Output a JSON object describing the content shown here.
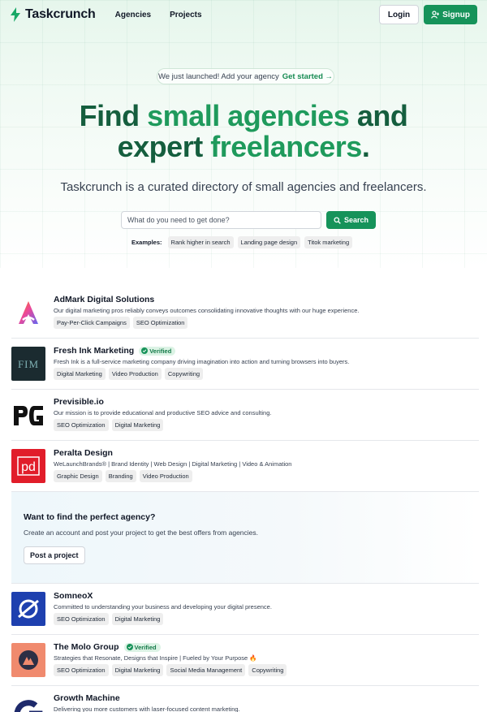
{
  "header": {
    "brand": "Taskcrunch",
    "nav": [
      "Agencies",
      "Projects"
    ],
    "login_label": "Login",
    "signup_label": "Signup"
  },
  "hero": {
    "pill_text": "We just launched! Add your agency",
    "pill_cta": "Get started →",
    "title_line1_a": "Find ",
    "title_line1_b": "small agencies",
    "title_line1_c": " and",
    "title_line2_a": "expert ",
    "title_line2_b": "freelancers",
    "title_line2_c": ".",
    "subtitle": "Taskcrunch is a curated directory of small agencies and freelancers.",
    "search_placeholder": "What do you need to get done?",
    "search_label": "Search",
    "examples_label": "Examples:",
    "examples": [
      "Rank higher in search",
      "Landing page design",
      "Titok marketing"
    ]
  },
  "listings": [
    {
      "name": "AdMark Digital Solutions",
      "verified": false,
      "description": "Our digital marketing pros reliably conveys outcomes consolidating innovative thoughts with our huge experience.",
      "tags": [
        "Pay-Per-Click Campaigns",
        "SEO Optimization"
      ]
    },
    {
      "name": "Fresh Ink Marketing",
      "verified": true,
      "description": "Fresh Ink is a full-service marketing company driving imagination into action and turning browsers into buyers.",
      "tags": [
        "Digital Marketing",
        "Video Production",
        "Copywriting"
      ]
    },
    {
      "name": "Previsible.io",
      "verified": false,
      "description": "Our mission is to provide educational and productive SEO advice and consulting.",
      "tags": [
        "SEO Optimization",
        "Digital Marketing"
      ]
    },
    {
      "name": "Peralta Design",
      "verified": false,
      "description": "WeLaunchBrands® | Brand Identity | Web Design | Digital Marketing | Video & Animation",
      "tags": [
        "Graphic Design",
        "Branding",
        "Video Production"
      ]
    },
    {
      "name": "SomneoX",
      "verified": false,
      "description": "Committed to understanding your business and developing your digital presence.",
      "tags": [
        "SEO Optimization",
        "Digital Marketing"
      ]
    },
    {
      "name": "The Molo Group",
      "verified": true,
      "description": "Strategies that Resonate, Designs that Inspire | Fueled by Your Purpose 🔥",
      "tags": [
        "SEO Optimization",
        "Digital Marketing",
        "Social Media Management",
        "Copywriting"
      ]
    },
    {
      "name": "Growth Machine",
      "verified": false,
      "description": "Delivering you more customers with laser-focused content marketing.",
      "tags": []
    }
  ],
  "verified_label": "Verified",
  "cta": {
    "title": "Want to find the perfect agency?",
    "text": "Create an account and post your project to get the best offers from agencies.",
    "button_label": "Post a project"
  },
  "logos": {
    "fim_text": "FIM",
    "pd_text": "pd"
  },
  "colors": {
    "brand_green": "#16935a",
    "title_dark": "#155e3e",
    "title_light": "#1f9a5c",
    "verified_bg": "#dcf3e5",
    "fresh_ink_logo_bg": "#1b2b30",
    "peralta_logo_bg": "#e11d2a",
    "somneox_logo_bg": "#1e40af",
    "molo_logo_bg": "#f08a6e",
    "growth_logo_bg": "#1e2a6b"
  }
}
